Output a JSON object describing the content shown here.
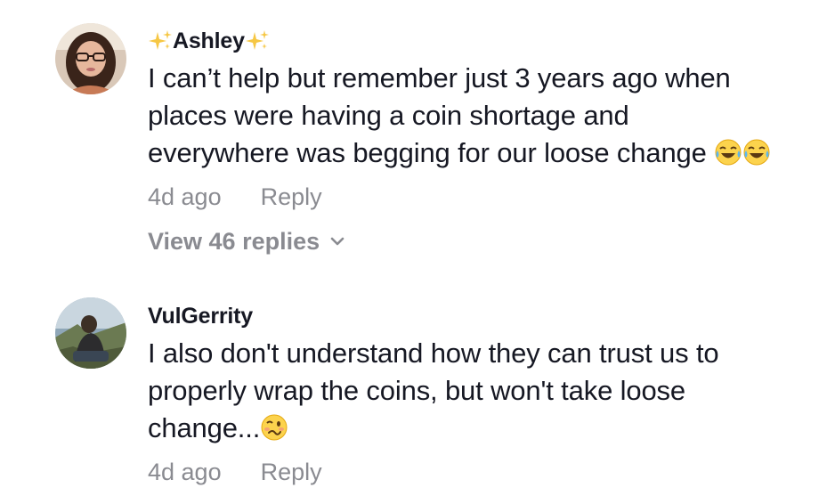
{
  "comments": [
    {
      "username": "Ashley",
      "username_decoration": "sparkles-emoji",
      "text_lines": [
        "I can’t help but remember just 3 years ago when",
        "places were having a coin shortage and",
        "everywhere was begging for our loose change"
      ],
      "trailing_emoji": [
        "face-with-tears-of-joy-emoji",
        "face-with-tears-of-joy-emoji"
      ],
      "time": "4d ago",
      "reply_label": "Reply",
      "view_replies_label": "View 46 replies",
      "avatar_icon": "user-avatar-ashley"
    },
    {
      "username": "VulGerrity",
      "text_lines": [
        "I also don't understand how they can trust us to",
        "properly wrap the coins, but won't take loose",
        "change..."
      ],
      "trailing_emoji": [
        "woozy-face-emoji"
      ],
      "time": "4d ago",
      "reply_label": "Reply",
      "avatar_icon": "user-avatar-vulgerrity"
    }
  ],
  "colors": {
    "primary_text": "#161823",
    "secondary_text": "#8a8b91",
    "background": "#ffffff"
  }
}
